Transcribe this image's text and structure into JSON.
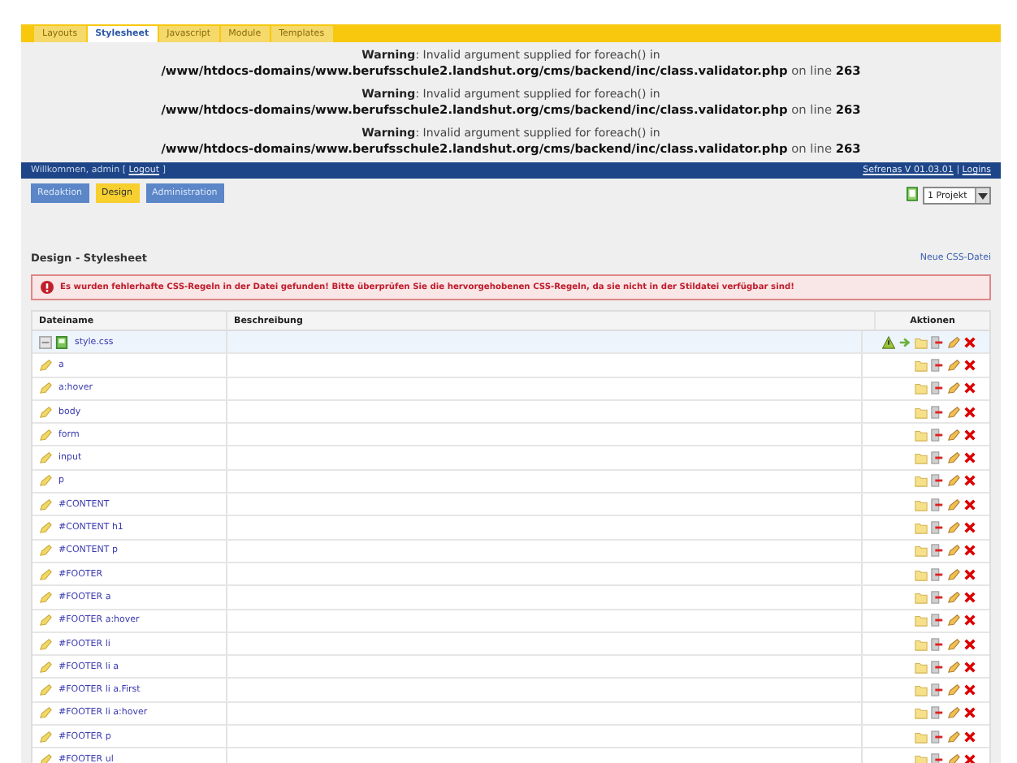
{
  "top_tabs": [
    {
      "label": "Layouts",
      "selected": false
    },
    {
      "label": "Stylesheet",
      "selected": true
    },
    {
      "label": "Javascript",
      "selected": false
    },
    {
      "label": "Module",
      "selected": false
    },
    {
      "label": "Templates",
      "selected": false
    }
  ],
  "warnings": [
    {
      "label": "Warning",
      "message": ": Invalid argument supplied for foreach() in",
      "path": "/www/htdocs-domains/www.berufsschule2.landshut.org/cms/backend/inc/class.validator.php",
      "suffix": " on line ",
      "line": "263"
    },
    {
      "label": "Warning",
      "message": ": Invalid argument supplied for foreach() in",
      "path": "/www/htdocs-domains/www.berufsschule2.landshut.org/cms/backend/inc/class.validator.php",
      "suffix": " on line ",
      "line": "263"
    },
    {
      "label": "Warning",
      "message": ": Invalid argument supplied for foreach() in",
      "path": "/www/htdocs-domains/www.berufsschule2.landshut.org/cms/backend/inc/class.validator.php",
      "suffix": " on line ",
      "line": "263"
    }
  ],
  "user_bar": {
    "welcome": "Willkommen, admin [",
    "logout": "Logout",
    "close": "]",
    "version": "Sefrenas V 01.03.01",
    "separator": "|",
    "logins": "Logins"
  },
  "nav_tabs": [
    {
      "label": "Redaktion",
      "selected": false
    },
    {
      "label": "Design",
      "selected": true
    },
    {
      "label": "Administration",
      "selected": false
    }
  ],
  "project_select": {
    "value": "1 Projekt"
  },
  "page_title": "Design - Stylesheet",
  "new_link": "Neue CSS-Datei",
  "error": "Es wurden fehlerhafte CSS-Regeln in der Datei gefunden! Bitte überprüfen Sie die hervorgehobenen CSS-Regeln, da sie nicht in der Stildatei verfügbar sind!",
  "table": {
    "columns": [
      "Dateiname",
      "Beschreibung",
      "Aktionen"
    ],
    "rows": [
      {
        "kind": "file",
        "name": "style.css",
        "selected": true
      },
      {
        "kind": "rule",
        "name": "a",
        "selected": false
      },
      {
        "kind": "rule",
        "name": "a:hover",
        "selected": false
      },
      {
        "kind": "rule",
        "name": "body",
        "selected": false
      },
      {
        "kind": "rule",
        "name": "form",
        "selected": false
      },
      {
        "kind": "rule",
        "name": "input",
        "selected": false
      },
      {
        "kind": "rule",
        "name": "p",
        "selected": false
      },
      {
        "kind": "rule",
        "name": "#CONTENT",
        "selected": false
      },
      {
        "kind": "rule",
        "name": "#CONTENT h1",
        "selected": false
      },
      {
        "kind": "rule",
        "name": "#CONTENT p",
        "selected": false
      },
      {
        "kind": "rule",
        "name": "#FOOTER",
        "selected": false
      },
      {
        "kind": "rule",
        "name": "#FOOTER a",
        "selected": false
      },
      {
        "kind": "rule",
        "name": "#FOOTER a:hover",
        "selected": false
      },
      {
        "kind": "rule",
        "name": "#FOOTER li",
        "selected": false
      },
      {
        "kind": "rule",
        "name": "#FOOTER li a",
        "selected": false
      },
      {
        "kind": "rule",
        "name": "#FOOTER li a.First",
        "selected": false
      },
      {
        "kind": "rule",
        "name": "#FOOTER li a:hover",
        "selected": false
      },
      {
        "kind": "rule",
        "name": "#FOOTER p",
        "selected": false
      },
      {
        "kind": "rule",
        "name": "#FOOTER ul",
        "selected": false
      }
    ]
  }
}
